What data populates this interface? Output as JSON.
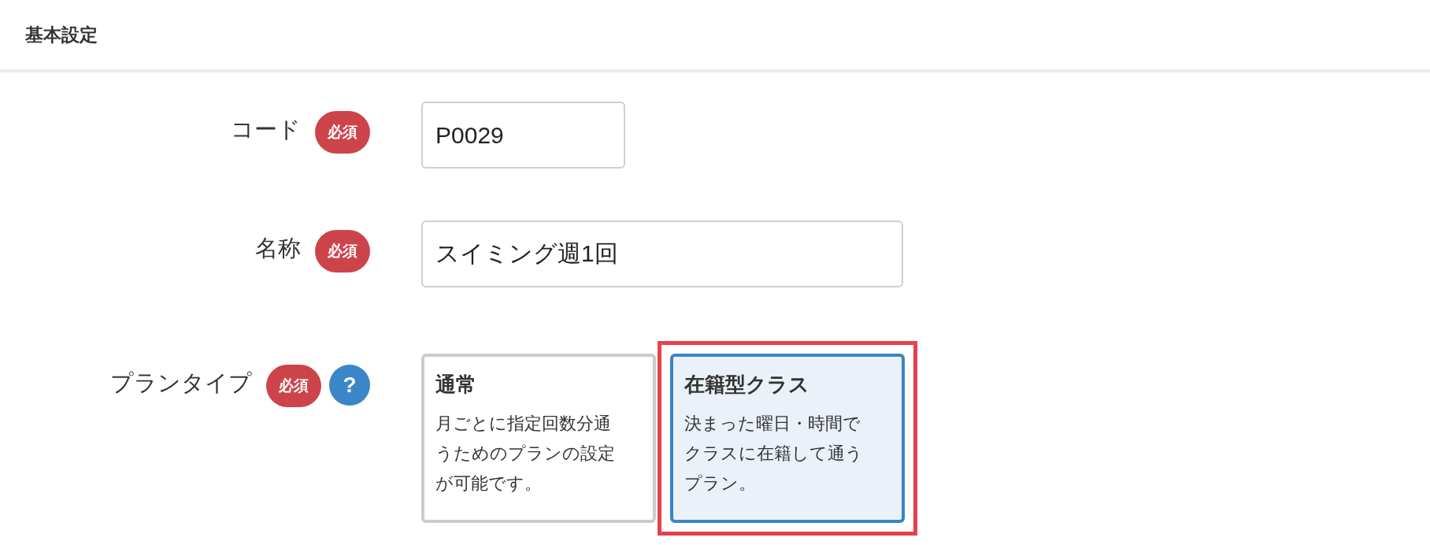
{
  "section_title": "基本設定",
  "fields": [
    {
      "label": "コード",
      "required_badge": "必須",
      "kind": "text",
      "value": "P0029"
    },
    {
      "label": "名称",
      "required_badge": "必須",
      "kind": "text",
      "value": "スイミング週1回"
    },
    {
      "label": "プランタイプ",
      "required_badge": "必須",
      "help": "?",
      "kind": "choice",
      "options": [
        {
          "title": "通常",
          "description": "月ごとに指定回数分通うためのプランの設定が可能です。",
          "selected": false
        },
        {
          "title": "在籍型クラス",
          "description": "決まった曜日・時間でクラスに在籍して通うプラン。",
          "selected": true
        }
      ]
    }
  ]
}
